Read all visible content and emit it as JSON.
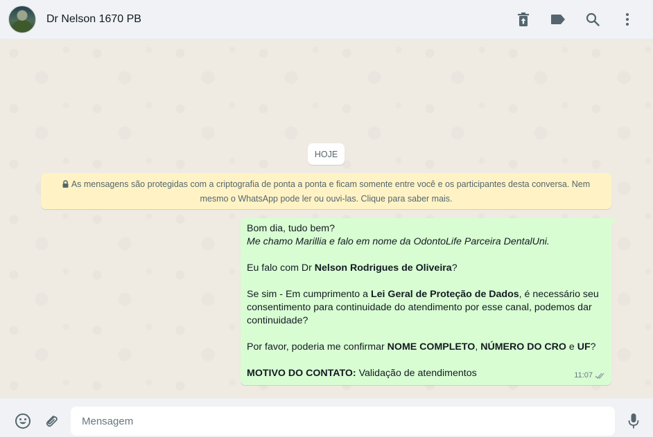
{
  "header": {
    "contact_name": "Dr Nelson 1670 PB",
    "actions": [
      "delete-icon",
      "label-icon",
      "search-icon",
      "menu-icon"
    ]
  },
  "chat": {
    "date_chip": "HOJE",
    "encryption_notice": "As mensagens são protegidas com a criptografia de ponta a ponta e ficam somente entre você e os participantes desta conversa. Nem mesmo o WhatsApp pode ler ou ouvi-las. Clique para saber mais.",
    "message": {
      "line1": "Bom dia, tudo bem?",
      "line2": "Me chamo Marillia e falo em nome da OdontoLife Parceira DentalUni.",
      "line3_pre": "Eu falo com Dr ",
      "line3_bold": "Nelson Rodrigues de Oliveira",
      "line3_post": "?",
      "line4_pre": "Se sim - Em cumprimento a ",
      "line4_bold": "Lei Geral de Proteção de Dados",
      "line4_post": ", é necessário seu consentimento para continuidade do atendimento por esse canal, podemos dar continuidade?",
      "line5_pre": "Por favor, poderia me confirmar ",
      "line5_bold1": "NOME COMPLETO",
      "line5_sep1": ", ",
      "line5_bold2": "NÚMERO DO CRO",
      "line5_sep2": " e ",
      "line5_bold3": "UF",
      "line5_post": "?",
      "line6_bold": "MOTIVO DO CONTATO:",
      "line6_post": " Validação de atendimentos",
      "time": "11:07",
      "status": "read"
    }
  },
  "footer": {
    "input_placeholder": "Mensagem",
    "input_value": ""
  },
  "colors": {
    "chat_bg": "#efeae2",
    "outgoing_bubble": "#d9fdd3",
    "encryption_bg": "#fff3c5",
    "icon_gray": "#54656f"
  }
}
